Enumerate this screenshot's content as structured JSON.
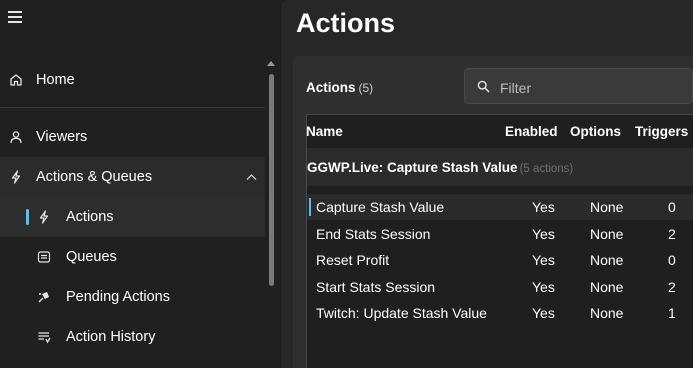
{
  "sidebar": {
    "items": [
      {
        "label": "Home",
        "icon": "home-icon"
      },
      {
        "label": "Viewers",
        "icon": "person-icon"
      },
      {
        "label": "Actions & Queues",
        "icon": "lightning-icon"
      },
      {
        "label": "Actions",
        "icon": "lightning-icon"
      },
      {
        "label": "Queues",
        "icon": "queue-icon"
      },
      {
        "label": "Pending Actions",
        "icon": "pending-icon"
      },
      {
        "label": "Action History",
        "icon": "history-icon"
      }
    ]
  },
  "main": {
    "title": "Actions",
    "card": {
      "title": "Actions",
      "count": "(5)",
      "filter_placeholder": "Filter"
    },
    "table": {
      "columns": [
        "Name",
        "Enabled",
        "Options",
        "Triggers"
      ],
      "group": {
        "title": "GGWP.Live: Capture Stash Value",
        "count": "(5 actions)"
      },
      "rows": [
        {
          "name": "Capture Stash Value",
          "enabled": "Yes",
          "options": "None",
          "triggers": "0"
        },
        {
          "name": "End Stats Session",
          "enabled": "Yes",
          "options": "None",
          "triggers": "2"
        },
        {
          "name": "Reset Profit",
          "enabled": "Yes",
          "options": "None",
          "triggers": "0"
        },
        {
          "name": "Start Stats Session",
          "enabled": "Yes",
          "options": "None",
          "triggers": "2"
        },
        {
          "name": "Twitch: Update Stash Value",
          "enabled": "Yes",
          "options": "None",
          "triggers": "1"
        }
      ]
    }
  },
  "colors": {
    "accent": "#4cc2ff",
    "background": "#202020",
    "card": "#2f2f2f"
  }
}
